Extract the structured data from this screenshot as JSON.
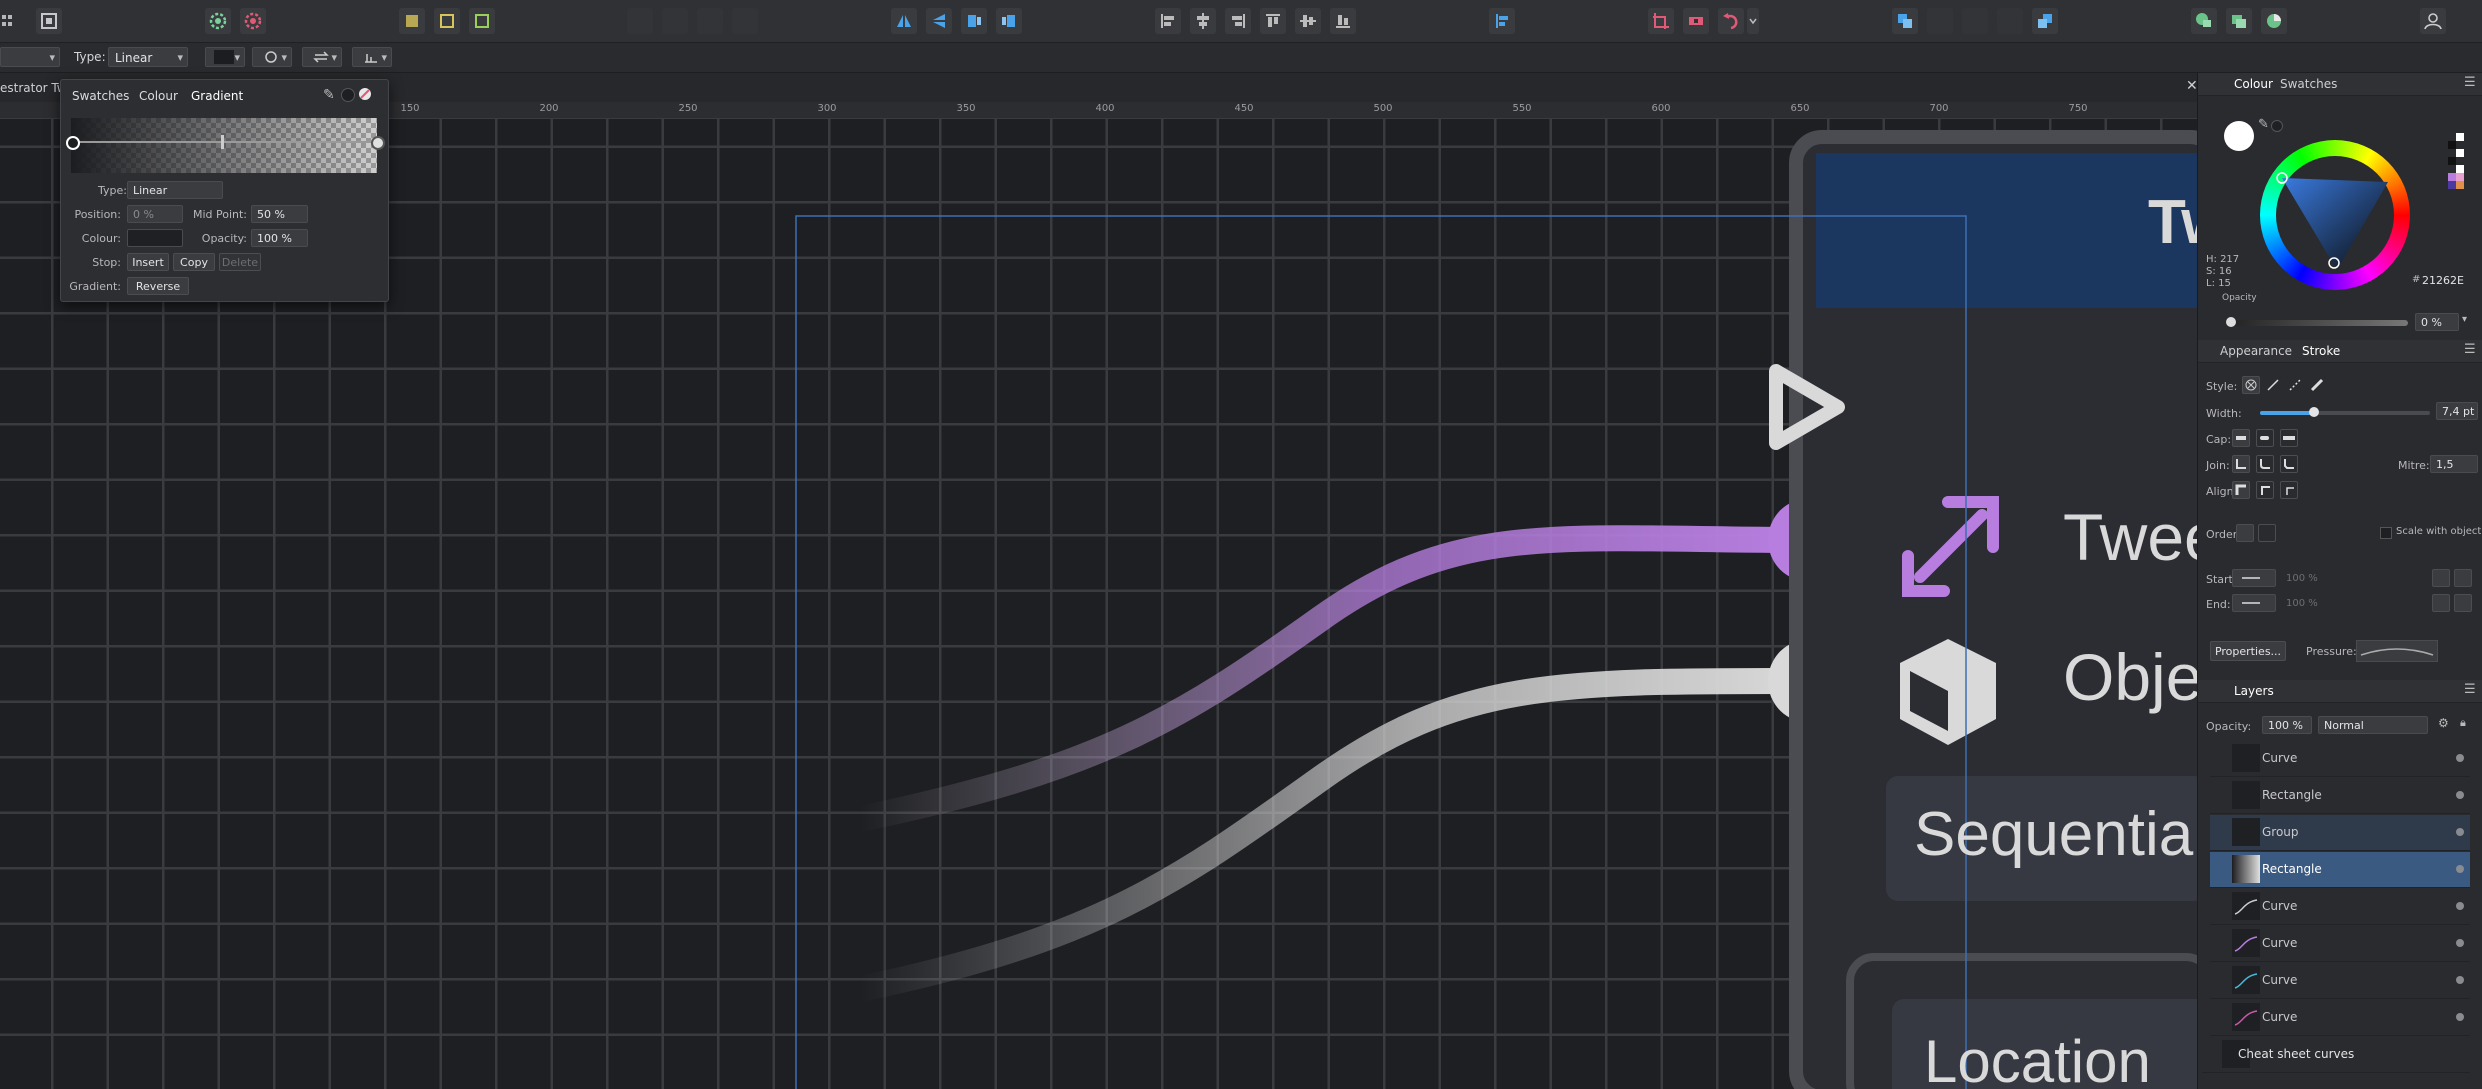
{
  "context_bar": {
    "type_label": "Type:",
    "type_value": "Linear"
  },
  "document": {
    "tab_title": "estrator Twe"
  },
  "ruler": {
    "ticks": [
      "150",
      "200",
      "250",
      "300",
      "350",
      "400",
      "450",
      "500",
      "550",
      "600",
      "650",
      "700",
      "750"
    ]
  },
  "canvas": {
    "heading_partial": "Tw",
    "tween_label": "Twee",
    "object_label": "Obje",
    "sequential_label": "Sequentia",
    "location_label": "Location",
    "colors": {
      "purple": "#b77ee0",
      "grey": "#d9d9d9",
      "blue_header": "#1b365f",
      "card": "#2b2d33"
    }
  },
  "gradient_popover": {
    "tabs": [
      "Swatches",
      "Colour",
      "Gradient"
    ],
    "type_label": "Type:",
    "type_value": "Linear",
    "position_label": "Position:",
    "position_value": "0 %",
    "midpoint_label": "Mid Point:",
    "midpoint_value": "50 %",
    "colour_label": "Colour:",
    "opacity_label": "Opacity:",
    "opacity_value": "100 %",
    "stop_label": "Stop:",
    "insert_label": "Insert",
    "copy_label": "Copy",
    "delete_label": "Delete",
    "gradient_label": "Gradient:",
    "reverse_label": "Reverse"
  },
  "colour_panel": {
    "tabs": [
      "Colour",
      "Swatches"
    ],
    "h": "H: 217",
    "s": "S: 16",
    "l": "L: 15",
    "hex": "21262E",
    "opacity_label": "Opacity",
    "opacity_value": "0 %"
  },
  "stroke_panel": {
    "tabs": [
      "Appearance",
      "Stroke"
    ],
    "style_label": "Style:",
    "width_label": "Width:",
    "width_value": "7,4 pt",
    "width_fraction": 0.32,
    "cap_label": "Cap:",
    "join_label": "Join:",
    "mitre_label": "Mitre:",
    "mitre_value": "1,5",
    "align_label": "Align:",
    "order_label": "Order:",
    "scale_label": "Scale with object",
    "start_label": "Start:",
    "start_pct": "100 %",
    "end_label": "End:",
    "end_pct": "100 %",
    "properties_label": "Properties...",
    "pressure_label": "Pressure:"
  },
  "layers_panel": {
    "title": "Layers",
    "opacity_label": "Opacity:",
    "opacity_value": "100 %",
    "blend_value": "Normal",
    "items": [
      {
        "name": "Curve",
        "selected": false
      },
      {
        "name": "Rectangle",
        "selected": false
      },
      {
        "name": "Group",
        "selected": false
      },
      {
        "name": "Rectangle",
        "selected": true
      },
      {
        "name": "Curve",
        "selected": false
      },
      {
        "name": "Curve",
        "selected": false
      },
      {
        "name": "Curve",
        "selected": false
      },
      {
        "name": "Curve",
        "selected": false
      },
      {
        "name": "Cheat sheet curves",
        "selected": false
      }
    ]
  }
}
